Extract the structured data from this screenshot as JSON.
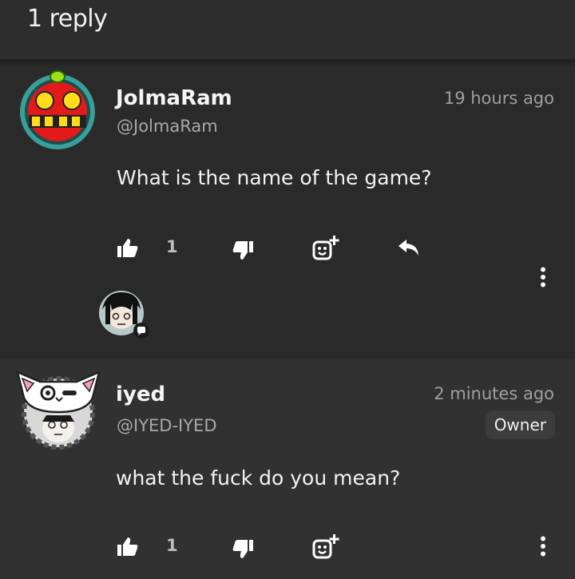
{
  "thread": {
    "reply_count_label": "1 reply"
  },
  "comments": [
    {
      "username": "JolmaRam",
      "handle": "@JolmaRam",
      "time": "19 hours ago",
      "text": "What is the name of the game?",
      "like_count": "1"
    },
    {
      "username": "iyed",
      "handle": "@IYED-IYED",
      "time": "2 minutes ago",
      "badge": "Owner",
      "text": "what the fuck do you mean?",
      "like_count": "1"
    }
  ],
  "icons": {
    "like": "thumbs-up-icon",
    "dislike": "thumbs-down-icon",
    "react": "add-emoji-icon",
    "reply": "reply-arrow-icon",
    "more": "more-vertical-icon"
  }
}
